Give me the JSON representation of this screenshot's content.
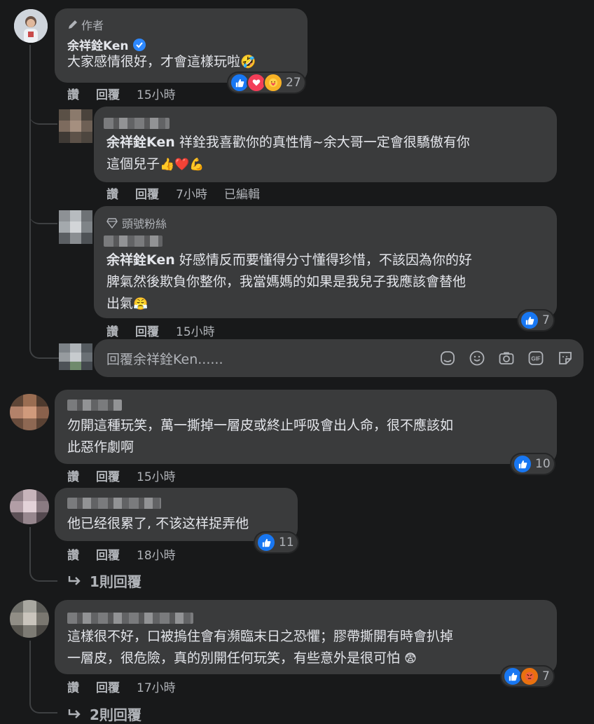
{
  "author_comment": {
    "badge": "作者",
    "name": "余祥銓Ken",
    "text": "大家感情很好，才會這樣玩啦",
    "emoji": "🤣",
    "like_label": "讚",
    "reply_label": "回覆",
    "time": "15小時",
    "reaction_count": "27"
  },
  "reply1": {
    "mention": "余祥銓Ken",
    "text_line1": "祥銓我喜歡你的真性情~余大哥一定會很驕傲有你",
    "text_line2": "這個兒子",
    "emoji": "👍❤️💪",
    "like_label": "讚",
    "reply_label": "回覆",
    "time": "7小時",
    "edited": "已編輯"
  },
  "reply2": {
    "badge": "頭號粉絲",
    "mention": "余祥銓Ken",
    "text_line1": "好感情反而要懂得分寸懂得珍惜，不該因為你的好",
    "text_line2": "脾氣然後欺負你整你，我當媽媽的如果是我兒子我應該會替他",
    "text_line3": "出氣",
    "emoji": "😤",
    "like_label": "讚",
    "reply_label": "回覆",
    "time": "15小時",
    "reaction_count": "7"
  },
  "reply_input": {
    "placeholder": "回覆余祥銓Ken......",
    "icons": [
      "sticker-face-icon",
      "emoji-icon",
      "camera-icon",
      "gif-icon",
      "sticker-icon"
    ]
  },
  "comment2": {
    "text_line1": "勿開這種玩笑，萬一撕掉一層皮或終止呼吸會出人命，很不應該如",
    "text_line2": "此惡作劇啊",
    "like_label": "讚",
    "reply_label": "回覆",
    "time": "15小時",
    "reaction_count": "10"
  },
  "comment3": {
    "text": "他已经很累了, 不该这样捉弄他",
    "like_label": "讚",
    "reply_label": "回覆",
    "time": "18小時",
    "reaction_count": "11",
    "replies_link": "1則回覆"
  },
  "comment4": {
    "text_line1": "這樣很不好，口被摀住會有瀕臨末日之恐懼；膠帶撕開有時會扒掉",
    "text_line2": "一層皮，很危險，真的別開任何玩笑，有些意外是很可怕",
    "emoji": "😨",
    "like_label": "讚",
    "reply_label": "回覆",
    "time": "17小時",
    "reaction_count": "7",
    "replies_link": "2則回覆"
  },
  "colors": {
    "background": "#18191a",
    "bubble": "#3a3b3c",
    "text": "#e4e6eb",
    "secondary": "#b0b3b8",
    "like_blue": "#1877f2",
    "love_red": "#f33e58",
    "verified_blue": "#2d88ff"
  }
}
